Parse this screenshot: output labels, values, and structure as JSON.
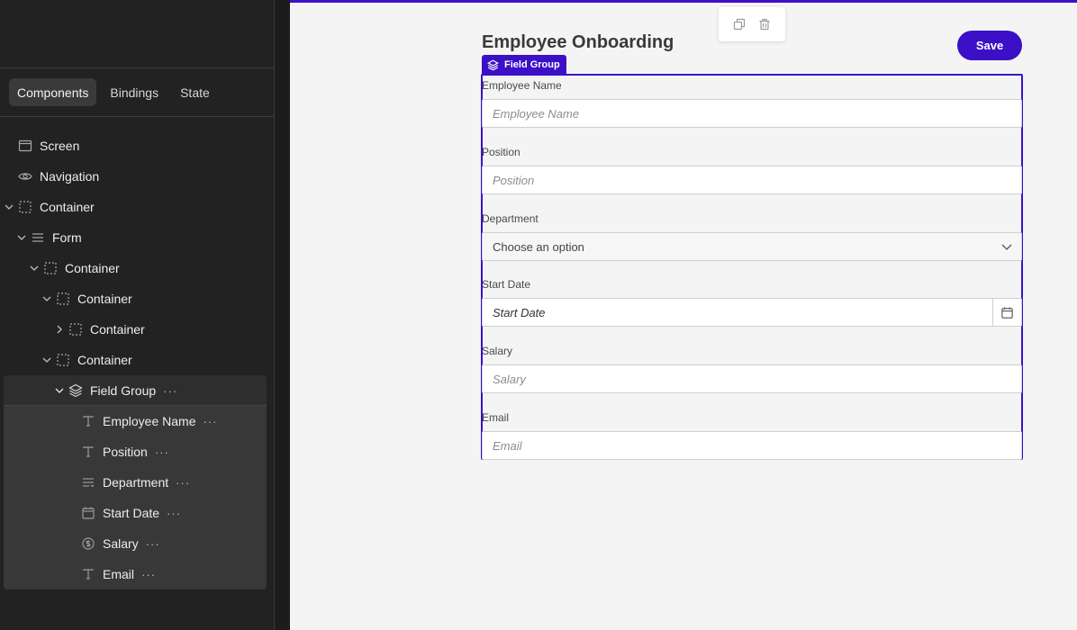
{
  "sidebar": {
    "tabs": [
      "Components",
      "Bindings",
      "State"
    ],
    "tree": [
      {
        "label": "Screen",
        "icon": "screen-icon"
      },
      {
        "label": "Navigation",
        "icon": "eye-icon"
      },
      {
        "label": "Container",
        "icon": "container-icon"
      },
      {
        "label": "Form",
        "icon": "form-icon"
      },
      {
        "label": "Container",
        "icon": "container-icon"
      },
      {
        "label": "Container",
        "icon": "container-icon"
      },
      {
        "label": "Container",
        "icon": "container-icon"
      },
      {
        "label": "Container",
        "icon": "container-icon"
      },
      {
        "label": "Field Group",
        "icon": "layers-icon"
      },
      {
        "label": "Employee Name",
        "icon": "text-icon"
      },
      {
        "label": "Position",
        "icon": "text-icon"
      },
      {
        "label": "Department",
        "icon": "select-icon"
      },
      {
        "label": "Start Date",
        "icon": "calendar-icon"
      },
      {
        "label": "Salary",
        "icon": "currency-icon"
      },
      {
        "label": "Email",
        "icon": "text-icon"
      }
    ],
    "more": "···"
  },
  "canvas": {
    "title": "Employee Onboarding",
    "save_label": "Save",
    "badge_label": "Field Group",
    "fields": [
      {
        "label": "Employee Name",
        "placeholder": "Employee Name"
      },
      {
        "label": "Position",
        "placeholder": "Position"
      },
      {
        "label": "Department",
        "value": "Choose an option"
      },
      {
        "label": "Start Date",
        "placeholder": "Start Date"
      },
      {
        "label": "Salary",
        "placeholder": "Salary"
      },
      {
        "label": "Email",
        "placeholder": "Email"
      }
    ]
  },
  "colors": {
    "accent": "#3b10c7",
    "sidebar_bg": "#222222",
    "canvas_bg": "#f4f4f4"
  }
}
